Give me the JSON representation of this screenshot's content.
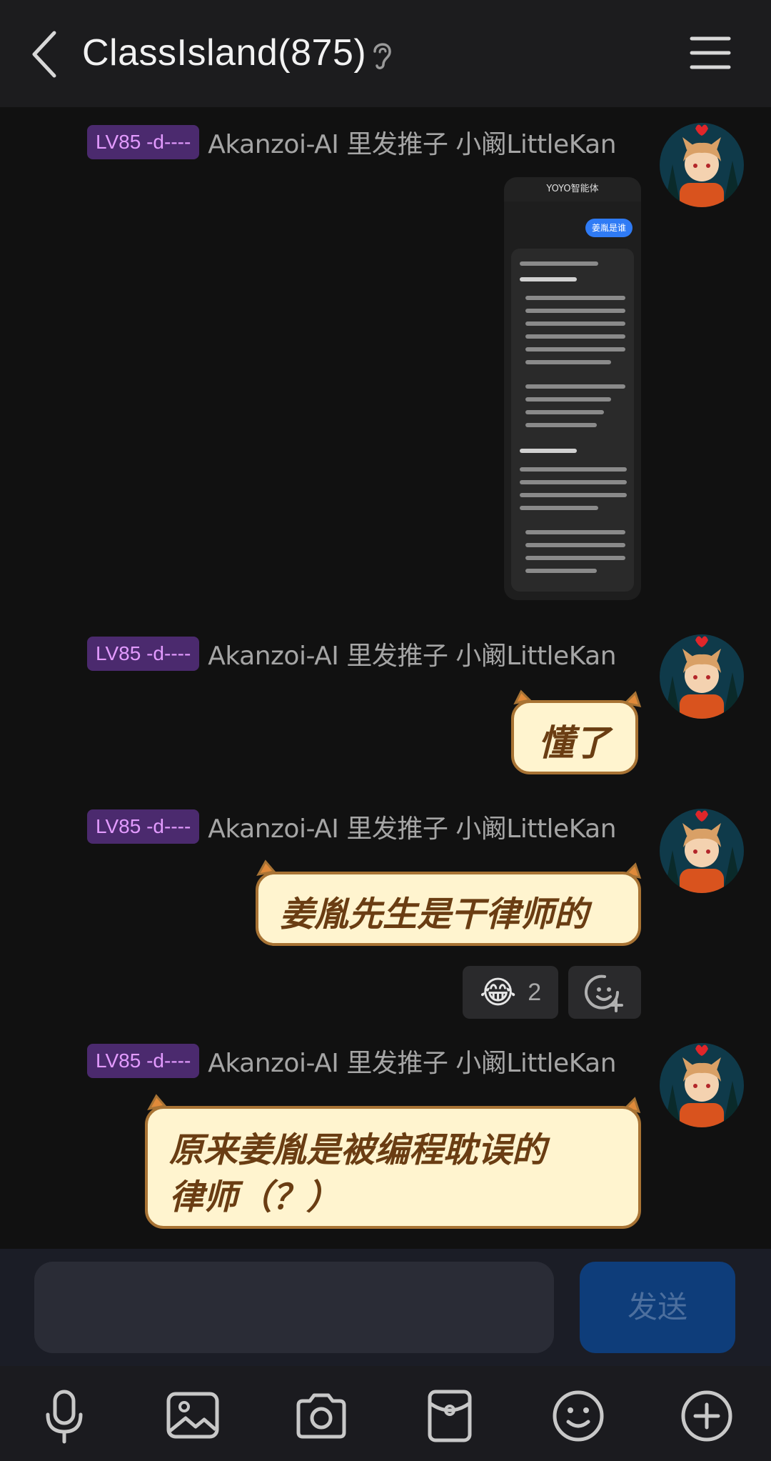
{
  "header": {
    "title": "ClassIsland(875)"
  },
  "messages": [
    {
      "badge": "LV85 -d----",
      "sender": "Akanzoi-AI 里发推子 小阚LittleKan",
      "type": "image",
      "image": {
        "app_title": "YOYO智能体",
        "query": "姜胤是谁"
      }
    },
    {
      "badge": "LV85 -d----",
      "sender": "Akanzoi-AI 里发推子 小阚LittleKan",
      "type": "sticker",
      "text": "懂了"
    },
    {
      "badge": "LV85 -d----",
      "sender": "Akanzoi-AI 里发推子 小阚LittleKan",
      "type": "sticker",
      "text": "姜胤先生是干律师的",
      "reaction": {
        "emoji": "😂",
        "count": "2"
      }
    },
    {
      "badge": "LV85 -d----",
      "sender": "Akanzoi-AI 里发推子 小阚LittleKan",
      "type": "sticker",
      "text_line1": "原来姜胤是被编程耽误的",
      "text_line2": "律师（？）"
    }
  ],
  "input": {
    "placeholder": "",
    "send_label": "发送"
  },
  "toolbar": {
    "icons": [
      "microphone-icon",
      "image-icon",
      "camera-icon",
      "red-packet-icon",
      "emoji-icon",
      "plus-icon"
    ]
  },
  "colors": {
    "badge_bg": "#4b2a6e",
    "badge_text": "#e39bff",
    "sticker_fill": "#fff4cf",
    "sticker_border": "#a87334",
    "send_button": "#0e3d7a"
  }
}
